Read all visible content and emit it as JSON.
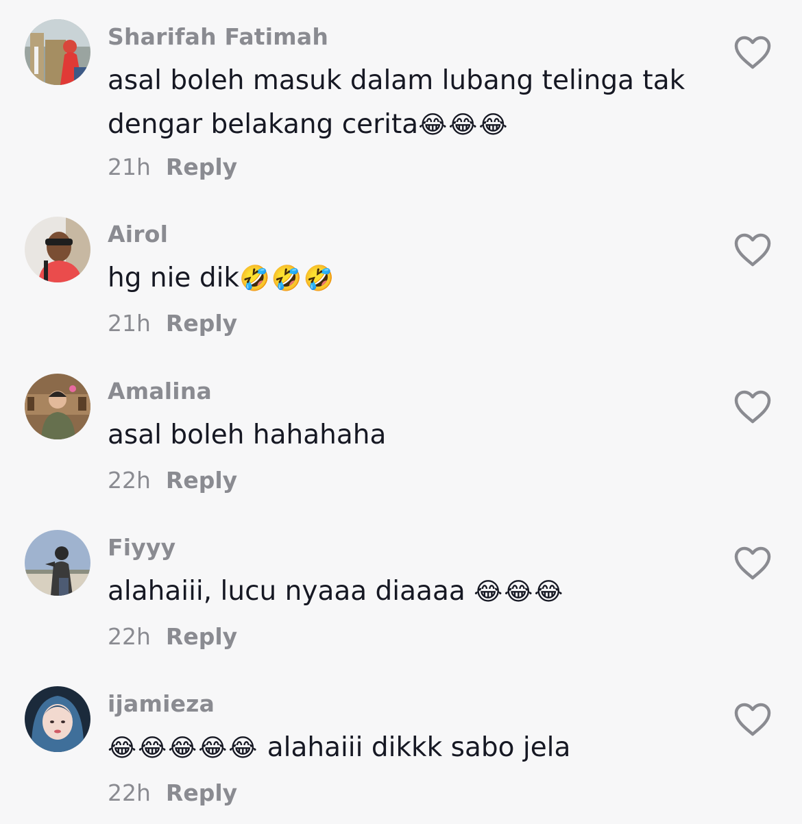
{
  "comments": [
    {
      "username": "Sharifah Fatimah",
      "text": "asal boleh masuk dalam lubang telinga tak dengar belakang cerita",
      "emoji": "😂😂😂",
      "time": "21h",
      "reply_label": "Reply"
    },
    {
      "username": "Airol",
      "text": "hg nie dik",
      "emoji": "🤣🤣🤣",
      "time": "21h",
      "reply_label": "Reply"
    },
    {
      "username": "Amalina",
      "text": "asal boleh hahahaha",
      "emoji": "",
      "time": "22h",
      "reply_label": "Reply"
    },
    {
      "username": "Fiyyy",
      "text": "alahaiii, lucu nyaaa diaaaa ",
      "emoji": "😂😂😂",
      "time": "22h",
      "reply_label": "Reply"
    },
    {
      "username": "ijamieza",
      "emoji_prefix": "😂😂😂😂😂",
      "text": " alahaiii dikkk sabo jela",
      "time": "22h",
      "reply_label": "Reply"
    }
  ],
  "icons": {
    "like": "heart-outline-icon",
    "avatar": "user-avatar"
  },
  "colors": {
    "background": "#f7f7f8",
    "username": "#8a8b91",
    "text": "#161823",
    "icon": "#8a8b91"
  }
}
